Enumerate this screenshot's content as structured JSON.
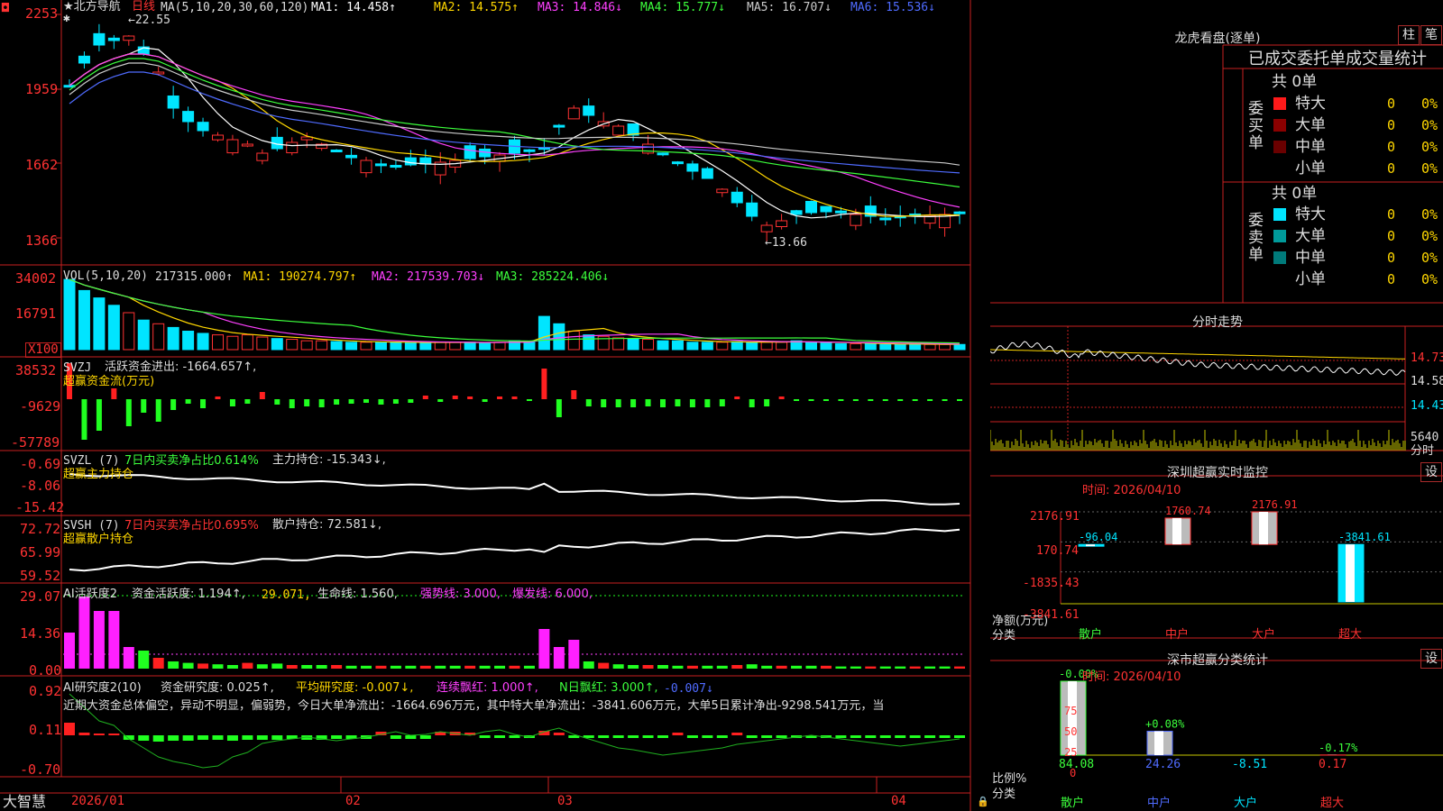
{
  "header": {
    "corner_mark": "◘",
    "stock_name": "★北方导航",
    "period": "日线",
    "ma_label": "MA(5,10,20,30,60,120)",
    "ma_values": [
      {
        "name": "MA1",
        "value": "14.458↑",
        "color": "#ffffff"
      },
      {
        "name": "MA2",
        "value": "14.575↑",
        "color": "#ffd700"
      },
      {
        "name": "MA3",
        "value": "14.846↓",
        "color": "#ff40ff"
      },
      {
        "name": "MA4",
        "value": "15.777↓",
        "color": "#3cff3c"
      },
      {
        "name": "MA5",
        "value": "16.707↓",
        "color": "#cccccc"
      },
      {
        "name": "MA6",
        "value": "15.536↓",
        "color": "#4f6bff"
      }
    ],
    "star_mark": "✱"
  },
  "price_axis": [
    "2253",
    "1959",
    "1662",
    "1366"
  ],
  "price_annotations": {
    "high": "22.55",
    "low": "13.66"
  },
  "volume": {
    "title": "VOL(5,10,20)",
    "value": "217315.000↑",
    "ma1": "MA1: 190274.797↑",
    "ma2": "MA2: 217539.703↓",
    "ma3": "MA3: 285224.406↓",
    "axis": [
      "34002",
      "16791",
      "X100"
    ]
  },
  "svzj": {
    "title": "SVZJ",
    "text": "活跃资金进出: -1664.657↑,",
    "subtitle": "超赢资金流(万元)",
    "axis": [
      "38532",
      "-9629",
      "-57789"
    ]
  },
  "svzl": {
    "title": "SVZL (7)",
    "text1": "7日内买卖净占比0.614%",
    "text2": "主力持仓: -15.343↓,",
    "subtitle": "超赢主力持仓",
    "axis": [
      "-0.69",
      "-8.06",
      "-15.42"
    ]
  },
  "svsh": {
    "title": "SVSH (7)",
    "text1": "7日内买卖净占比0.695%",
    "text2": "散户持仓: 72.581↓,",
    "subtitle": "超赢散户持仓",
    "axis": [
      "72.72",
      "65.99",
      "59.52"
    ]
  },
  "ai_active": {
    "title": "AI活跃度2",
    "t1": "资金活跃度: 1.194↑,",
    "t2": "29.071,",
    "t3": "生命线: 1.560,",
    "t4": "强势线: 3.000,",
    "t5": "爆发线: 6.000,",
    "axis": [
      "29.07",
      "14.36",
      "0.00"
    ]
  },
  "ai_research": {
    "title": "AI研究度2(10)",
    "t1": "资金研究度: 0.025↑,",
    "t2": "平均研究度: -0.007↓,",
    "t3": "连续飘红: 1.000↑,",
    "t4": "N日飘红: 3.000↑,",
    "t5": "-0.007↓",
    "summary": "近期大资金总体偏空，异动不明显，偏弱势，今日大单净流出：-1664.696万元，其中特大单净流出：-3841.606万元，大单5日累计净出-9298.541万元，当",
    "axis": [
      "0.92",
      "0.11",
      "-0.70"
    ]
  },
  "date_axis": {
    "brand": "大智慧",
    "labels": [
      "2026/01",
      "02",
      "03",
      "04"
    ]
  },
  "longhu": {
    "title": "龙虎看盘(逐单)",
    "btn_bar": "柱",
    "btn_pen": "笔",
    "tabs": [
      "已成交",
      "委托单",
      "成交量统计"
    ],
    "buy_total": "共 0单",
    "buy_label": "委买单",
    "sell_total": "共 0单",
    "sell_label": "委卖单",
    "buy_rows": [
      {
        "name": "特大",
        "count": "0",
        "pct": "0%",
        "color": "#ff1a1a"
      },
      {
        "name": "大单",
        "count": "0",
        "pct": "0%",
        "color": "#8a0000"
      },
      {
        "name": "中单",
        "count": "0",
        "pct": "0%",
        "color": "#6a0000"
      },
      {
        "name": "小单",
        "count": "0",
        "pct": "0%",
        "color": ""
      }
    ],
    "sell_rows": [
      {
        "name": "特大",
        "count": "0",
        "pct": "0%",
        "color": "#00e5ff"
      },
      {
        "name": "大单",
        "count": "0",
        "pct": "0%",
        "color": "#009a9a"
      },
      {
        "name": "中单",
        "count": "0",
        "pct": "0%",
        "color": "#007a7a"
      },
      {
        "name": "小单",
        "count": "0",
        "pct": "0%",
        "color": ""
      }
    ]
  },
  "intraday": {
    "title": "分时走势",
    "price_labels": [
      "14.73",
      "14.58",
      "14.43"
    ],
    "vol_label": "5640",
    "vol_unit": "分时"
  },
  "monitor": {
    "title": "深圳超赢实时监控",
    "settings": "设",
    "time": "时间: 2026/04/10",
    "axis": [
      "2176.91",
      "170.74",
      "-1835.43",
      "-3841.61"
    ],
    "ylabel": "净额(万元)",
    "xlabel": "分类",
    "categories": [
      "散户",
      "中户",
      "大户",
      "超大"
    ],
    "values": [
      -96.04,
      1760.74,
      2176.91,
      -3841.61
    ],
    "value_labels": [
      "-96.04",
      "1760.74",
      "2176.91",
      "-3841.61"
    ]
  },
  "classify": {
    "title": "深市超赢分类统计",
    "settings": "设",
    "time": "时间: 2026/04/10",
    "axis": [
      "75",
      "50",
      "25",
      "0"
    ],
    "ylabel": "比例%",
    "xlabel": "分类",
    "categories": [
      "散户",
      "中户",
      "大户",
      "超大"
    ],
    "ratios": [
      84.08,
      24.26,
      -8.51,
      0.17
    ],
    "ratio_labels": [
      "84.08",
      "24.26",
      "-8.51",
      "0.17"
    ],
    "changes": [
      "-0.00%",
      "+0.08%",
      "",
      "-0.17%"
    ]
  },
  "chart_data": [
    {
      "type": "line",
      "title": "分时走势",
      "y_ticks": [
        14.73,
        14.58,
        14.43
      ]
    },
    {
      "type": "bar",
      "title": "深圳超赢实时监控",
      "categories": [
        "散户",
        "中户",
        "大户",
        "超大"
      ],
      "values": [
        -96.04,
        1760.74,
        2176.91,
        -3841.61
      ],
      "ylabel": "净额(万元)",
      "xlabel": "分类",
      "ylim": [
        -3841.61,
        2176.91
      ]
    },
    {
      "type": "bar",
      "title": "深市超赢分类统计",
      "categories": [
        "散户",
        "中户",
        "大户",
        "超大"
      ],
      "values": [
        84.08,
        24.26,
        -8.51,
        0.17
      ],
      "ylabel": "比例%",
      "xlabel": "分类",
      "ylim": [
        0,
        75
      ]
    }
  ],
  "colors": {
    "up": "#ff3232",
    "down": "#00e5ff",
    "grid": "#b01c1c",
    "frame": "#c82020"
  }
}
